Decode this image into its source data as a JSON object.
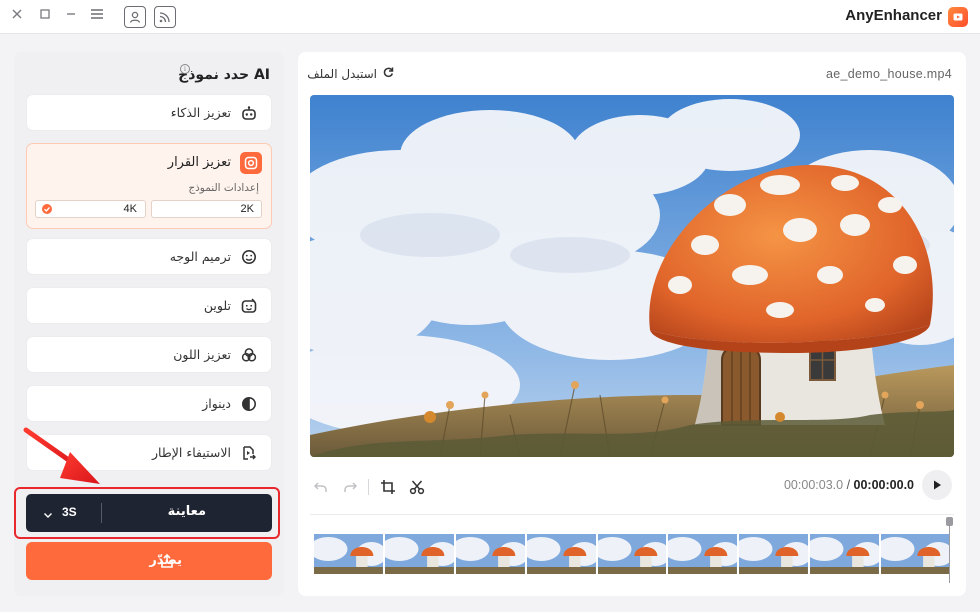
{
  "window": {
    "title": "AnyEnhancer",
    "controls": [
      "close-icon",
      "maximize-icon",
      "minimize-icon",
      "menu-icon",
      "account-icon",
      "feedback-icon"
    ]
  },
  "sidebar": {
    "title": "حدد نموذج AI",
    "models": [
      {
        "label": "تعزيز الذكاء",
        "icon": "robot-icon",
        "active": false
      },
      {
        "label": "تعزيز القرار",
        "icon": "resolution-icon",
        "active": true,
        "settings_label": "إعدادات النموذج",
        "options": [
          "2K",
          "4K"
        ],
        "selected": "4K"
      },
      {
        "label": "ترميم الوجه",
        "icon": "face-icon",
        "active": false
      },
      {
        "label": "تلوين",
        "icon": "colorize-icon",
        "active": false
      },
      {
        "label": "تعزيز اللون",
        "icon": "color-circles-icon",
        "active": false
      },
      {
        "label": "دينواز",
        "icon": "denoise-icon",
        "active": false
      },
      {
        "label": "الاستيفاء الإطار",
        "icon": "frame-interpolation-icon",
        "active": false
      }
    ],
    "preview_button": {
      "label": "معاينة",
      "duration": "3S"
    },
    "export_button": {
      "label": "يصدّر"
    }
  },
  "main": {
    "replace_file_label": "استبدل الملف",
    "filename": "ae_demo_house.mp4",
    "time_current": "00:00:03.0",
    "time_separator": "/",
    "time_total": "00:00:00.0"
  },
  "colors": {
    "accent": "#ff6a3d",
    "preview_bar": "#1f2433",
    "highlight": "#e8282d"
  }
}
